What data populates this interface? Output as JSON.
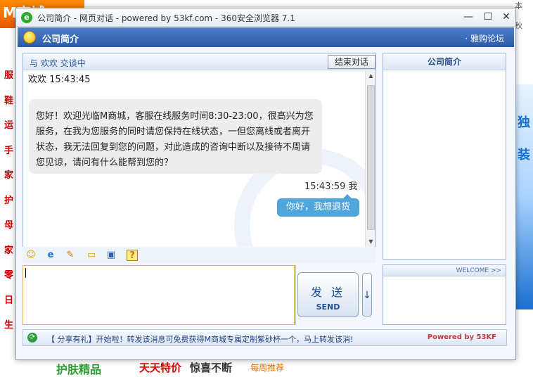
{
  "window": {
    "title": "公司简介 - 网页对话 - powered by 53kf.com - 360安全浏览器 7.1",
    "minimize_glyph": "—",
    "maximize_glyph": "☐",
    "close_glyph": "✕"
  },
  "header": {
    "title": "公司简介",
    "forum_link": "· 雅购论坛"
  },
  "chat": {
    "status_text": "与 欢欢 交谈中",
    "end_button": "结束对话",
    "messages": [
      {
        "sender": "欢欢 15:43:45",
        "text": "您好！欢迎光临M商城，客服在线服务时间8:30-23:00，很高兴为您服务，在我为您服务的同时请您保持在线状态，一但您离线或者离开状态，我无法回复到您的问题，对此造成的咨询中断以及接待不周请您见谅，请问有什么能帮到您的？"
      },
      {
        "sender": "15:43:59 我",
        "text": "你好，我想退货"
      }
    ]
  },
  "sidebar": {
    "title": "公司简介",
    "welcome": "WELCOME >>"
  },
  "toolbar": {
    "icons": [
      "smiley-icon",
      "ie-icon",
      "edit-icon",
      "folder-icon",
      "save-icon",
      "help-icon"
    ],
    "glyphs": [
      "☺",
      "e",
      "✎",
      "▭",
      "▣",
      "?"
    ]
  },
  "input": {
    "value": ""
  },
  "send": {
    "label_zh": "发 送",
    "label_en": "SEND",
    "arrow": "↓"
  },
  "footer": {
    "text": "【 分享有礼】开始啦！转发该消息可免费获得M商城专属定制紫砂杯一个，马上转发该消!",
    "powered": "Powered by 53KF"
  },
  "background": {
    "logo_text": "M商城",
    "categories": [
      "服",
      "鞋",
      "运",
      "手",
      "家",
      "护",
      "母",
      "家",
      "零",
      "日",
      "生"
    ],
    "top_right": [
      "本",
      "秋"
    ],
    "banner_chars": [
      "独",
      "装"
    ],
    "bottom_items": [
      "护肤精品",
      "天天特价",
      "惊喜不断",
      "每周推荐"
    ]
  }
}
